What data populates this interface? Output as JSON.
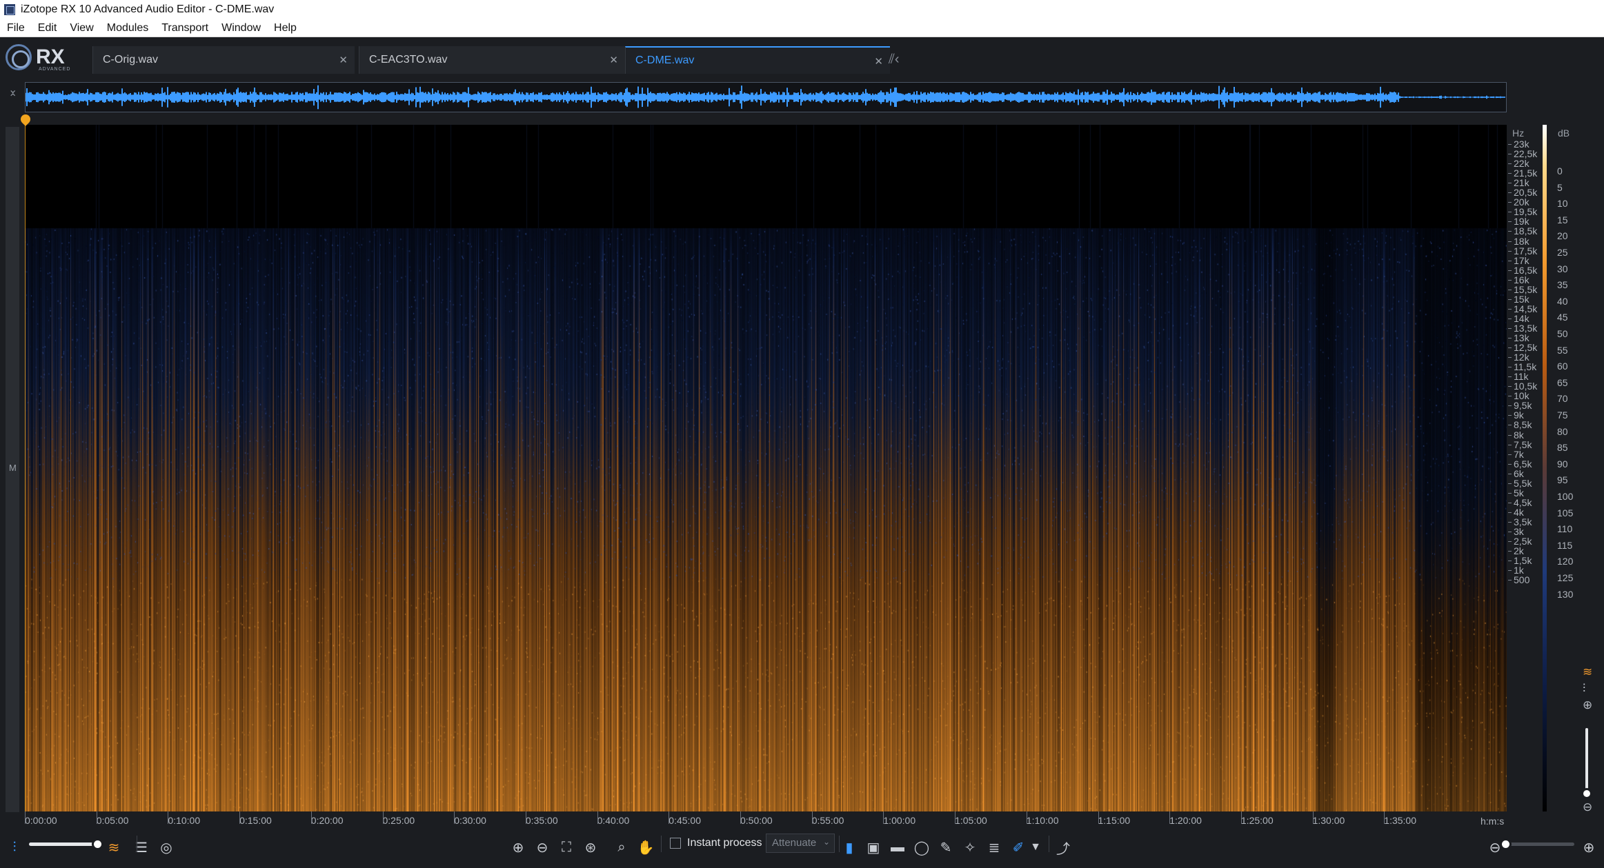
{
  "window": {
    "title": "iZotope RX 10 Advanced Audio Editor - C-DME.wav"
  },
  "menu": [
    "File",
    "Edit",
    "View",
    "Modules",
    "Transport",
    "Window",
    "Help"
  ],
  "logo": {
    "text": "RX",
    "sub": "ADVANCED"
  },
  "tabs": [
    {
      "label": "C-Orig.wav",
      "active": false
    },
    {
      "label": "C-EAC3TO.wav",
      "active": false
    },
    {
      "label": "C-DME.wav",
      "active": true
    }
  ],
  "channel": {
    "label": "M"
  },
  "hz_axis": {
    "title": "Hz",
    "ticks": [
      "23k",
      "22,5k",
      "22k",
      "21,5k",
      "21k",
      "20,5k",
      "20k",
      "19,5k",
      "19k",
      "18,5k",
      "18k",
      "17,5k",
      "17k",
      "16,5k",
      "16k",
      "15,5k",
      "15k",
      "14,5k",
      "14k",
      "13,5k",
      "13k",
      "12,5k",
      "12k",
      "11,5k",
      "11k",
      "10,5k",
      "10k",
      "9,5k",
      "9k",
      "8,5k",
      "8k",
      "7,5k",
      "7k",
      "6,5k",
      "6k",
      "5,5k",
      "5k",
      "4,5k",
      "4k",
      "3,5k",
      "3k",
      "2,5k",
      "2k",
      "1,5k",
      "1k",
      "500"
    ]
  },
  "db_axis": {
    "title": "dB",
    "ticks": [
      "0",
      "5",
      "10",
      "15",
      "20",
      "25",
      "30",
      "35",
      "40",
      "45",
      "50",
      "55",
      "60",
      "65",
      "70",
      "75",
      "80",
      "85",
      "90",
      "95",
      "100",
      "105",
      "110",
      "115",
      "120",
      "125",
      "130"
    ]
  },
  "time_ruler": {
    "ticks": [
      "0:00:00",
      "0:05:00",
      "0:10:00",
      "0:15:00",
      "0:20:00",
      "0:25:00",
      "0:30:00",
      "0:35:00",
      "0:40:00",
      "0:45:00",
      "0:50:00",
      "0:55:00",
      "1:00:00",
      "1:05:00",
      "1:10:00",
      "1:15:00",
      "1:20:00",
      "1:25:00",
      "1:30:00",
      "1:35:00"
    ],
    "unit": "h:m:s"
  },
  "toolbar": {
    "instant_process_label": "Instant process",
    "instant_process_checked": false,
    "mode_value": "Attenuate",
    "waveform_spectrogram_blend": 1.0
  },
  "colors": {
    "accent": "#3d9bff",
    "playhead": "#f2a51f",
    "spectro_hot": "#f29a2e",
    "spectro_cold": "#0d1c44"
  }
}
